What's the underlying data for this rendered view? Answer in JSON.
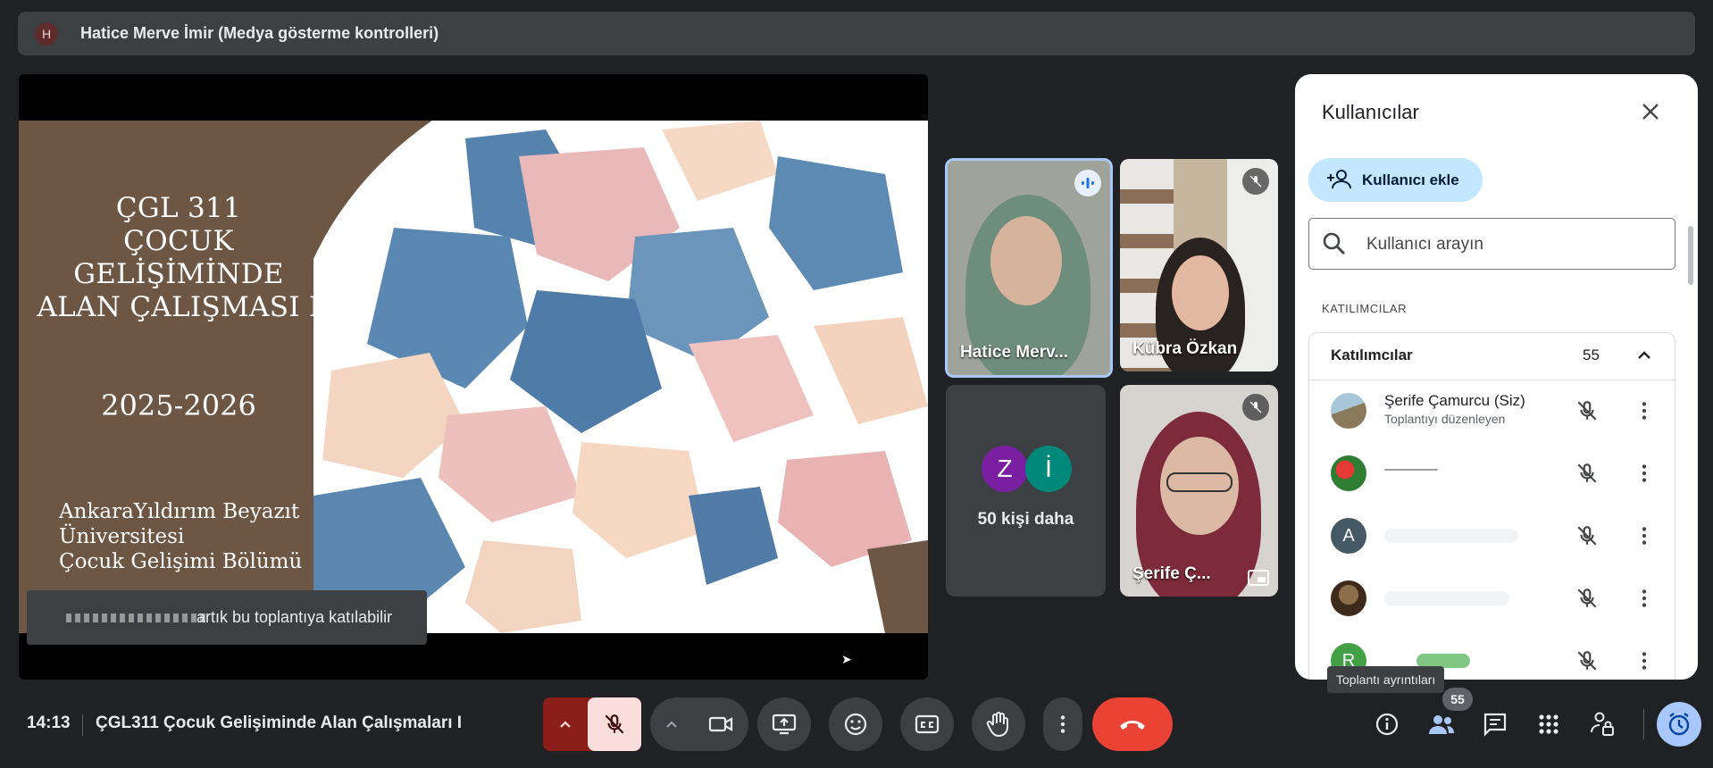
{
  "presenter_bar": {
    "avatar_letter": "H",
    "label": "Hatice Merve İmir (Medya gösterme kontrolleri)"
  },
  "slide": {
    "title_lines": [
      "ÇGL 311",
      "ÇOCUK",
      "GELİŞİMİNDE",
      "ALAN ÇALIŞMASI I"
    ],
    "year": "2025-2026",
    "university_lines": [
      "AnkaraYıldırım Beyazıt",
      "Üniversitesi",
      "Çocuk Gelişimi Bölümü"
    ]
  },
  "toast": {
    "text": "artık bu toplantıya katılabilir"
  },
  "tiles": {
    "hatice": {
      "name": "Hatice Merv..."
    },
    "kubra": {
      "name": "Kübra Özkan"
    },
    "more": {
      "avatar1": "Z",
      "avatar2": "İ",
      "label": "50 kişi daha"
    },
    "serife": {
      "name": "Şerife Ç..."
    }
  },
  "panel": {
    "title": "Kullanıcılar",
    "add_button": "Kullanıcı ekle",
    "search_placeholder": "Kullanıcı arayın",
    "section_label": "KATILIMCILAR",
    "group_label": "Katılımcılar",
    "group_count": "55",
    "participants": [
      {
        "name": "Şerife Çamurcu (Siz)",
        "subtitle": "Toplantıyı düzenleyen"
      },
      {
        "name": ""
      },
      {
        "name": "",
        "avatar_letter": "A"
      },
      {
        "name": ""
      },
      {
        "name": "",
        "avatar_letter": "R"
      }
    ]
  },
  "tooltip": "Toplantı ayrıntıları",
  "bottom_bar": {
    "time": "14:13",
    "meeting_title": "ÇGL311 Çocuk Gelişiminde Alan Çalışmaları I",
    "people_count": "55"
  },
  "colors": {
    "background": "#202124",
    "accent": "#a8c7fa",
    "end_call": "#ea4335",
    "mic_muted_bg": "#f9dedc",
    "mic_group_bg": "#8c1d18",
    "add_button_bg": "#c2e7ff"
  }
}
